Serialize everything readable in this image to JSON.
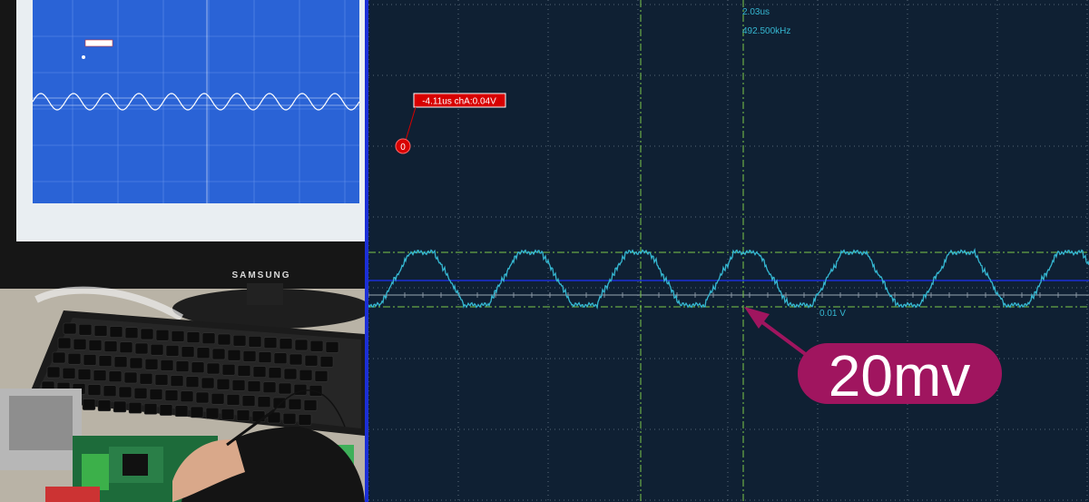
{
  "scope": {
    "cursor_time": "2.03us",
    "cursor_freq": "492.500kHz",
    "marker_readout": "-4.11us chA:0.04V",
    "marker_badge": "0",
    "level_label": "0.01 V",
    "colors": {
      "background": "#0f2033",
      "grid": "#6f7e8c",
      "trace": "#35b7d1",
      "cursor": "#7cc94a",
      "baseline": "#1b2fd6",
      "marker": "#d80000",
      "annotation": "#a0155f"
    }
  },
  "annotation": {
    "label": "20mv"
  },
  "photo": {
    "monitor_brand": "SAMSUNG"
  }
}
